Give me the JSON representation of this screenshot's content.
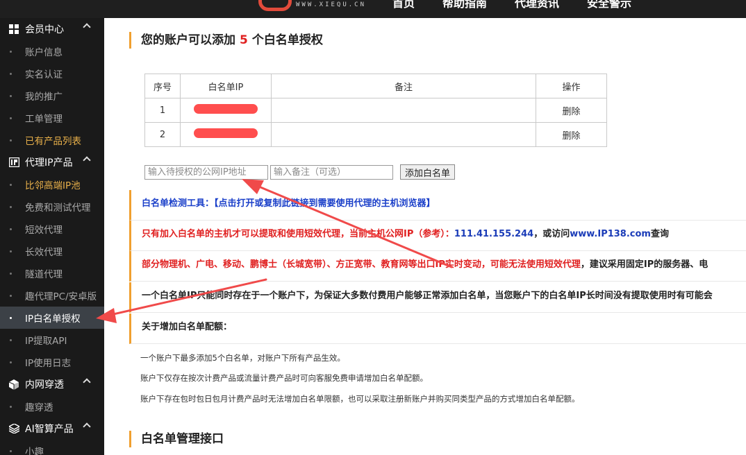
{
  "topbar": {
    "logo_text": "WWW.XIEQU.CN",
    "nav": [
      "首页",
      "帮助指南",
      "代理资讯",
      "安全警示"
    ]
  },
  "sidebar": {
    "groups": [
      {
        "label": "会员中心",
        "icon": "grid-icon",
        "items": [
          {
            "label": "账户信息",
            "style": "normal"
          },
          {
            "label": "实名认证",
            "style": "normal"
          },
          {
            "label": "我的推广",
            "style": "normal"
          },
          {
            "label": "工单管理",
            "style": "normal"
          },
          {
            "label": "已有产品列表",
            "style": "gold"
          }
        ]
      },
      {
        "label": "代理IP产品",
        "icon": "ip-icon",
        "items": [
          {
            "label": "比邻高端IP池",
            "style": "gold"
          },
          {
            "label": "免费和测试代理",
            "style": "normal"
          },
          {
            "label": "短效代理",
            "style": "normal"
          },
          {
            "label": "长效代理",
            "style": "normal"
          },
          {
            "label": "隧道代理",
            "style": "normal"
          },
          {
            "label": "趣代理PC/安卓版",
            "style": "normal"
          },
          {
            "label": "IP白名单授权",
            "style": "active"
          },
          {
            "label": "IP提取API",
            "style": "normal"
          },
          {
            "label": "IP使用日志",
            "style": "normal"
          }
        ]
      },
      {
        "label": "内网穿透",
        "icon": "cube-icon",
        "items": [
          {
            "label": "趣穿透",
            "style": "normal"
          }
        ]
      },
      {
        "label": "AI智算产品",
        "icon": "layers-icon",
        "items": [
          {
            "label": "小趣",
            "style": "normal"
          }
        ]
      }
    ]
  },
  "main": {
    "title_prefix": "您的账户可以添加",
    "title_count": "5",
    "title_suffix": "个白名单授权",
    "table": {
      "headers": [
        "序号",
        "白名单IP",
        "备注",
        "操作"
      ],
      "rows": [
        {
          "index": "1",
          "note": "",
          "action": "删除"
        },
        {
          "index": "2",
          "note": "",
          "action": "删除"
        }
      ]
    },
    "ip_input_placeholder": "输入待授权的公网IP地址",
    "note_input_placeholder": "输入备注（可选）",
    "add_button": "添加白名单",
    "notices": {
      "tool_label": "白名单检测工具：",
      "tool_link": "【点击打开或复制此链接到需要使用代理的主机浏览器】",
      "ip_text": "只有加入白名单的主机才可以提取和使用短效代理，当前主机公网IP（参考）：",
      "ip_value": "111.41.155.244",
      "ip_visit": "，或访问",
      "ip_site": "www.IP138.com",
      "ip_query": "查询",
      "isp_red": "部分物理机、广电、移动、鹏博士（长城宽带）、方正宽带、教育网等出口IP实时变动，可能无法使用短效代理",
      "isp_black": "，建议采用固定IP的服务器、电",
      "single_account": "一个白名单IP只能同时存在于一个账户下，为保证大多数付费用户能够正常添加白名单，当您账户下的白名单IP长时间没有提取使用时有可能会",
      "quota_title": "关于增加白名单配额："
    },
    "quota_lines": [
      "一个账户下最多添加5个白名单，对账户下所有产品生效。",
      "账户下仅存在按次计费产品或流量计费产品时可向客服免费申请增加白名单配额。",
      "账户下存在包时包日包月计费产品时无法增加白名单限额，也可以采取注册新账户并购买同类型产品的方式增加白名单配额。"
    ],
    "api_title": "白名单管理接口"
  },
  "colors": {
    "accent_bar": "#f0a030",
    "highlight_red": "#e02020",
    "link_blue": "#1a3fc9",
    "annotation_arrow": "#f04a4a"
  }
}
